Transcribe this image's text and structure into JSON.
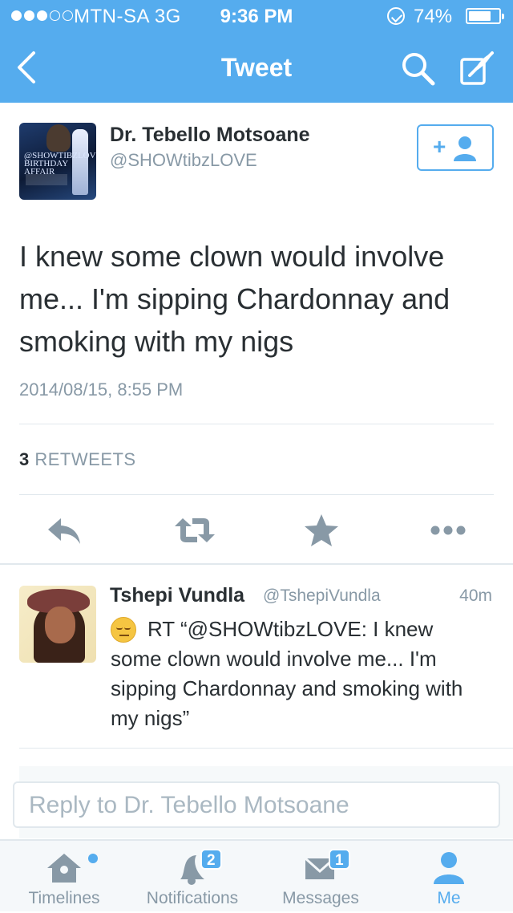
{
  "status_bar": {
    "carrier": "MTN-SA  3G",
    "time": "9:36 PM",
    "battery_percent": "74%",
    "battery_level": 0.74,
    "signal_bars_filled": 3,
    "signal_bars_total": 5
  },
  "nav": {
    "title": "Tweet",
    "back_icon": "chevron-left-icon",
    "search_icon": "search-icon",
    "compose_icon": "compose-quill-icon"
  },
  "tweet": {
    "author_name": "Dr. Tebello Motsoane",
    "author_handle": "@SHOWtibzLOVE",
    "avatar_text": "@SHOWTIBZLOVE BIRTHDAY AFFAIR FRI 22NDAUG",
    "follow_label": "+",
    "text": "I knew some clown would involve me... I'm sipping Chardonnay and smoking with my nigs",
    "timestamp": "2014/08/15, 8:55 PM",
    "retweet_count": "3",
    "retweet_label": "RETWEETS"
  },
  "actions": [
    "reply-icon",
    "retweet-icon",
    "favorite-star-icon",
    "more-dots-icon"
  ],
  "reply": {
    "name": "Tshepi Vundla",
    "handle": "@TshepiVundla",
    "time": "40m",
    "text": "RT “@SHOWtibzLOVE: I knew some clown would involve me... I'm sipping Chardonnay and smoking with my nigs”"
  },
  "reply_box": {
    "placeholder": "Reply to Dr. Tebello Motsoane"
  },
  "tabs": [
    {
      "label": "Timelines",
      "icon": "home-icon",
      "badge": ""
    },
    {
      "label": "Notifications",
      "icon": "bell-icon",
      "badge": "2"
    },
    {
      "label": "Messages",
      "icon": "envelope-icon",
      "badge": "1"
    },
    {
      "label": "Me",
      "icon": "person-icon",
      "badge": ""
    }
  ],
  "colors": {
    "accent": "#55acee",
    "text": "#292f33",
    "muted": "#8899a6"
  }
}
